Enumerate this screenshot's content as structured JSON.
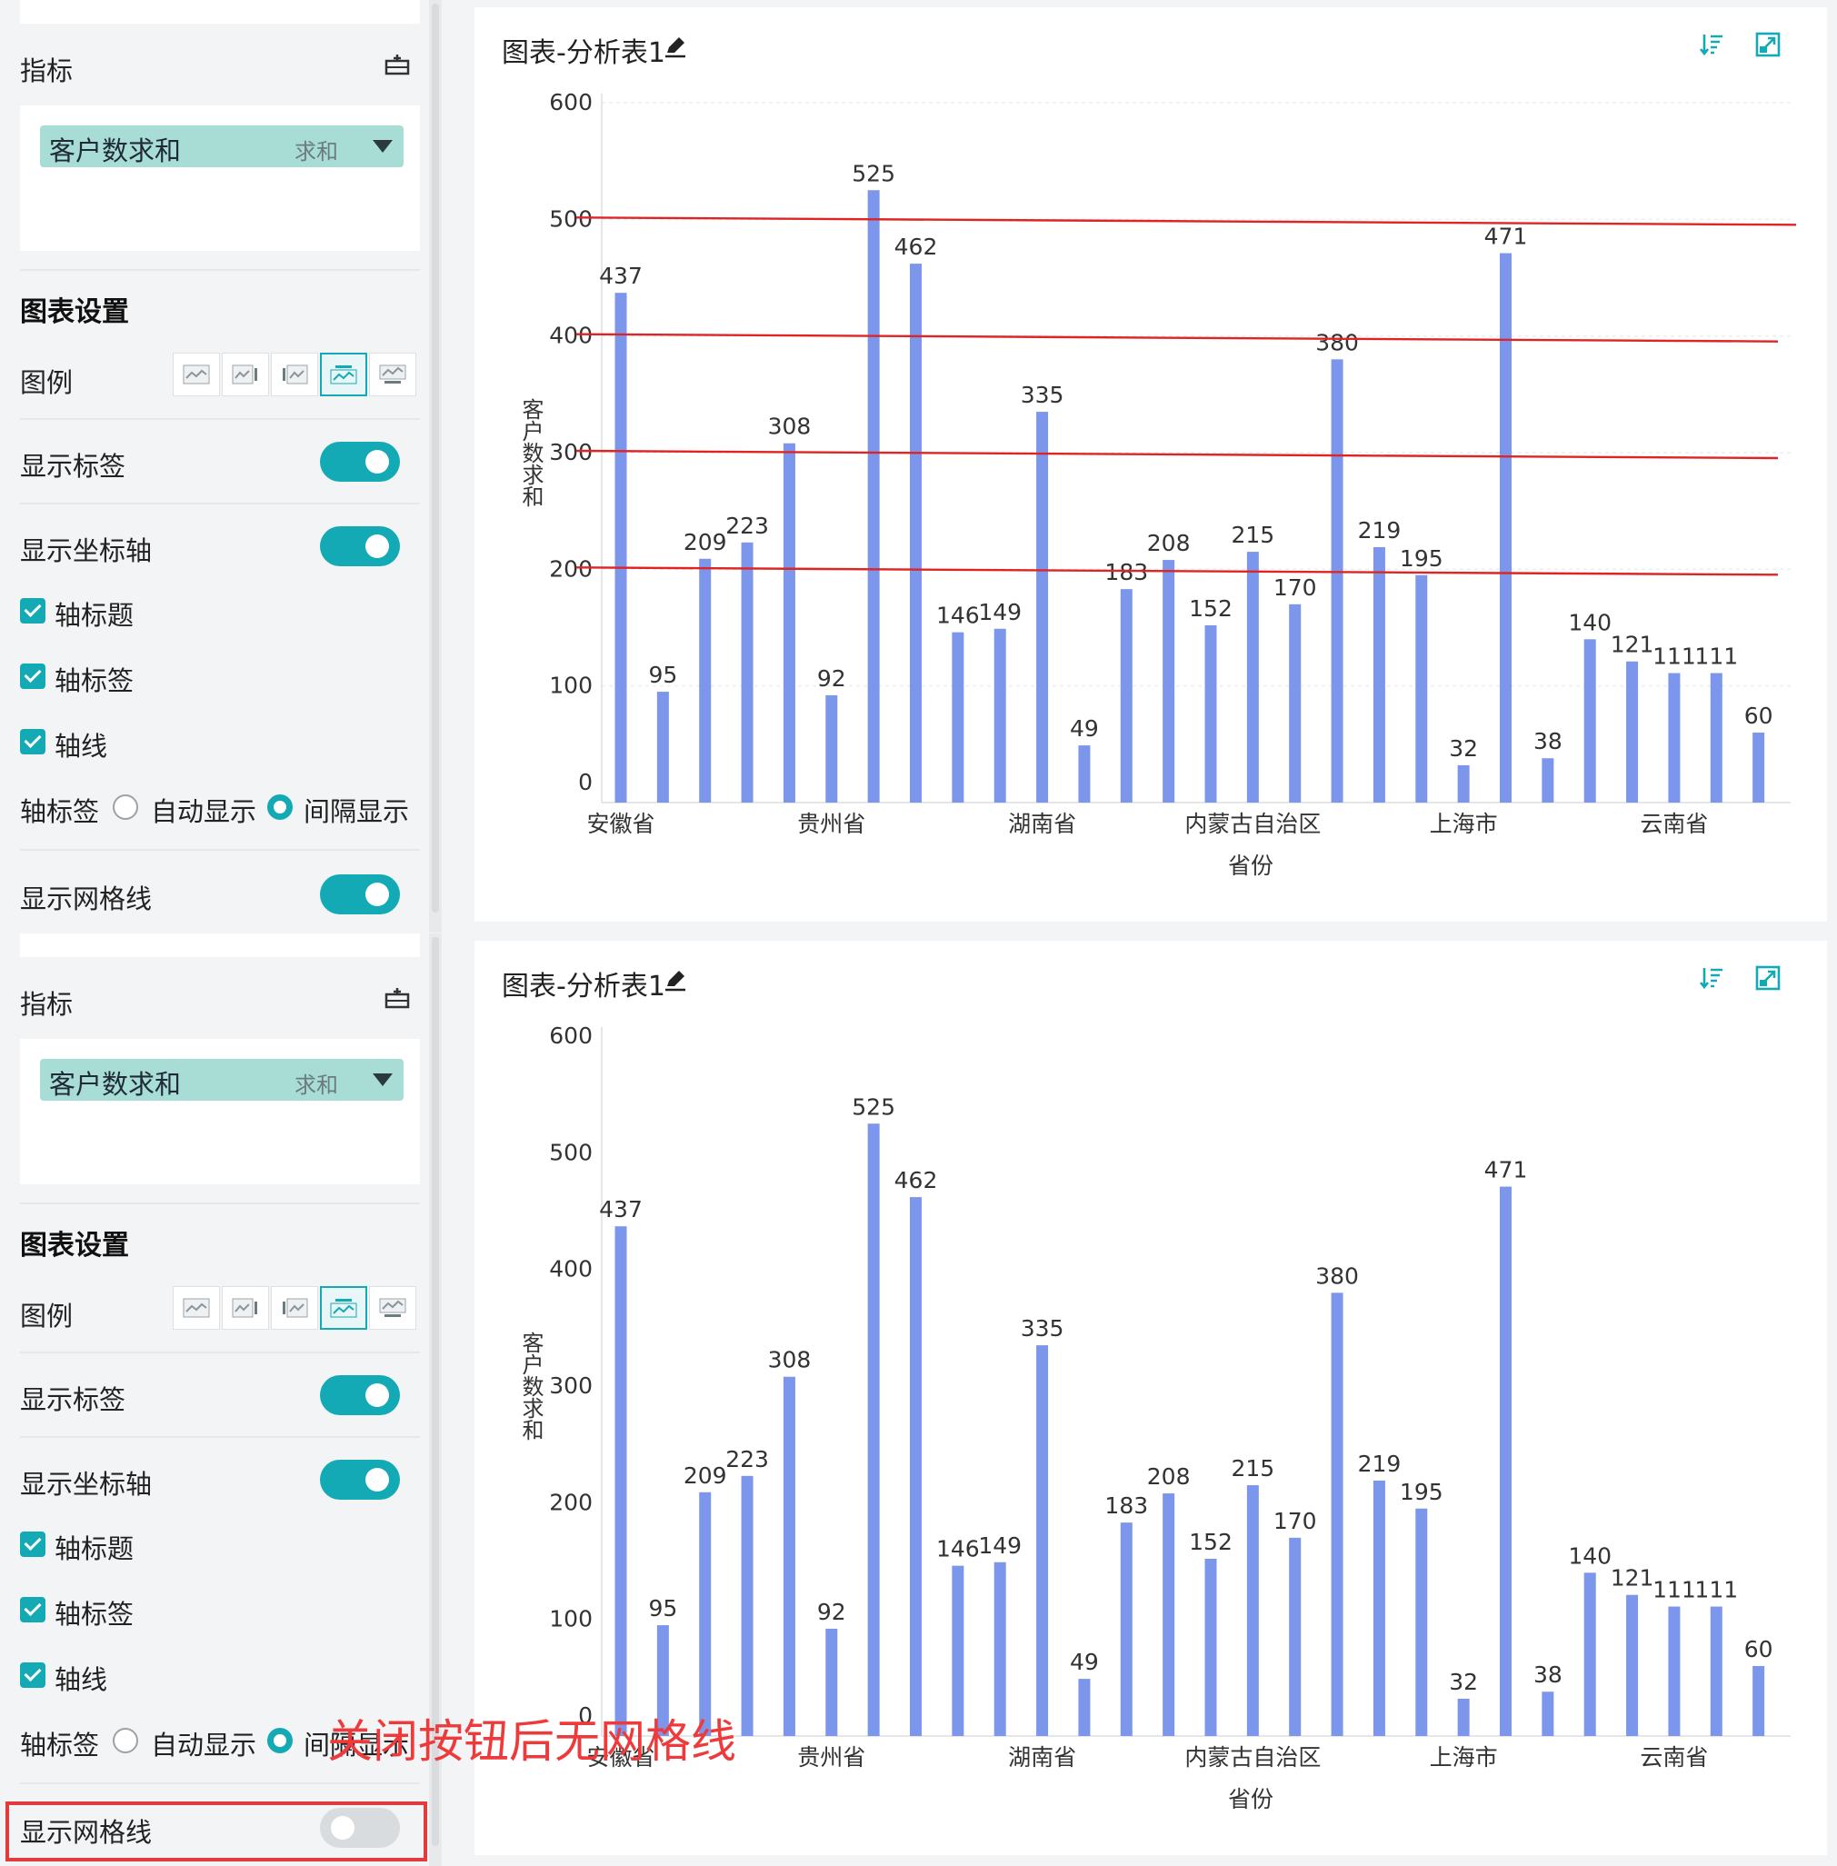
{
  "panels": [
    {
      "id": "top",
      "sidebar": {
        "metric_title": "指标",
        "field_name": "客户数求和",
        "field_agg": "求和",
        "chart_settings_title": "图表设置",
        "legend_label": "图例",
        "show_labels": "显示标签",
        "show_labels_on": true,
        "show_axis": "显示坐标轴",
        "show_axis_on": true,
        "axis_title": "轴标题",
        "axis_tick_labels": "轴标签",
        "axis_line": "轴线",
        "axis_label_mode_label": "轴标签",
        "axis_label_auto": "自动显示",
        "axis_label_interval": "间隔显示",
        "show_grid": "显示网格线",
        "show_grid_on": true
      },
      "chart": {
        "title": "图表-分析表1"
      }
    },
    {
      "id": "bot",
      "sidebar": {
        "metric_title": "指标",
        "field_name": "客户数求和",
        "field_agg": "求和",
        "chart_settings_title": "图表设置",
        "legend_label": "图例",
        "show_labels": "显示标签",
        "show_labels_on": true,
        "show_axis": "显示坐标轴",
        "show_axis_on": true,
        "axis_title": "轴标题",
        "axis_tick_labels": "轴标签",
        "axis_line": "轴线",
        "axis_label_mode_label": "轴标签",
        "axis_label_auto": "自动显示",
        "axis_label_interval": "间隔显示",
        "show_grid": "显示网格线",
        "show_grid_on": false
      },
      "chart": {
        "title": "图表-分析表1"
      }
    }
  ],
  "annotation": "关闭按钮后无网格线",
  "colors": {
    "accent": "#13a9b5",
    "bar": "#7b96ea",
    "grid_highlight": "#e02424",
    "annotation": "#ee3a3a"
  },
  "icons": {
    "edit": "pencil-icon",
    "sort": "sort-icon",
    "expand": "expand-icon",
    "export": "export-icon"
  },
  "chart_data": [
    {
      "type": "bar",
      "xlabel": "省份",
      "ylabel": "客户数求和",
      "ylim": [
        0,
        600
      ],
      "yticks": [
        0,
        100,
        200,
        300,
        400,
        500,
        600
      ],
      "grid": true,
      "x_tick_labels": [
        "安徽省",
        "贵州省",
        "湖南省",
        "内蒙古自治区",
        "上海市",
        "云南省"
      ],
      "values": [
        437,
        95,
        209,
        223,
        308,
        92,
        525,
        462,
        146,
        149,
        335,
        49,
        183,
        208,
        152,
        215,
        170,
        380,
        219,
        195,
        32,
        471,
        38,
        140,
        121,
        111,
        111,
        60
      ]
    },
    {
      "type": "bar",
      "xlabel": "省份",
      "ylabel": "客户数求和",
      "ylim": [
        0,
        600
      ],
      "yticks": [
        0,
        100,
        200,
        300,
        400,
        500,
        600
      ],
      "grid": false,
      "x_tick_labels": [
        "安徽省",
        "贵州省",
        "湖南省",
        "内蒙古自治区",
        "上海市",
        "云南省"
      ],
      "values": [
        437,
        95,
        209,
        223,
        308,
        92,
        525,
        462,
        146,
        149,
        335,
        49,
        183,
        208,
        152,
        215,
        170,
        380,
        219,
        195,
        32,
        471,
        38,
        140,
        121,
        111,
        111,
        60
      ]
    }
  ]
}
